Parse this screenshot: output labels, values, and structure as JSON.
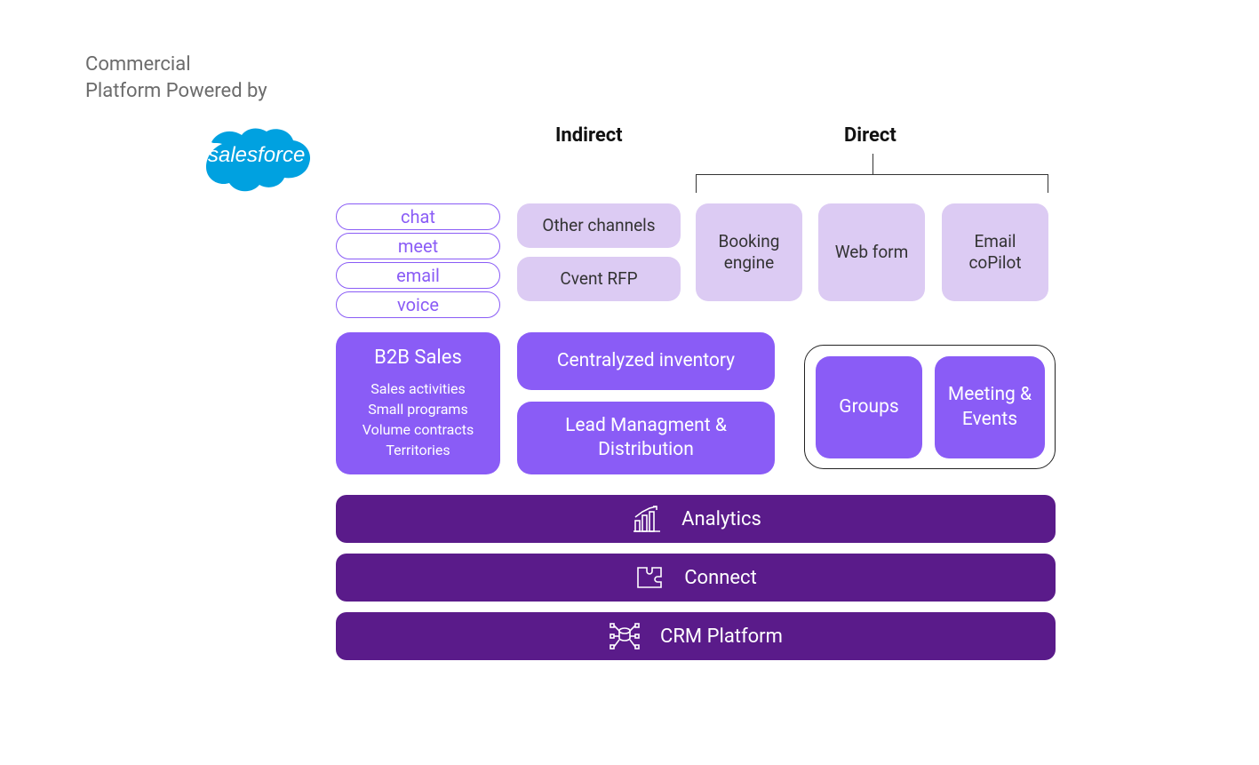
{
  "header": {
    "line1": "Commercial",
    "line2": "Platform Powered by",
    "logo_text": "salesforce"
  },
  "columns": {
    "indirect_label": "Indirect",
    "direct_label": "Direct"
  },
  "pills": [
    "chat",
    "meet",
    "email",
    "voice"
  ],
  "indirect_boxes": [
    "Other  channels",
    "Cvent RFP"
  ],
  "direct_boxes": [
    "Booking engine",
    "Web form",
    "Email coPilot"
  ],
  "b2b": {
    "title": "B2B Sales",
    "items": [
      "Sales activities",
      "Small programs",
      "Volume contracts",
      "Territories"
    ]
  },
  "centralized": "Centralyzed inventory",
  "lead": "Lead Managment & Distribution",
  "groups": "Groups",
  "meeting_events": "Meeting & Events",
  "bars": {
    "analytics": "Analytics",
    "connect": "Connect",
    "crm": "CRM Platform"
  }
}
